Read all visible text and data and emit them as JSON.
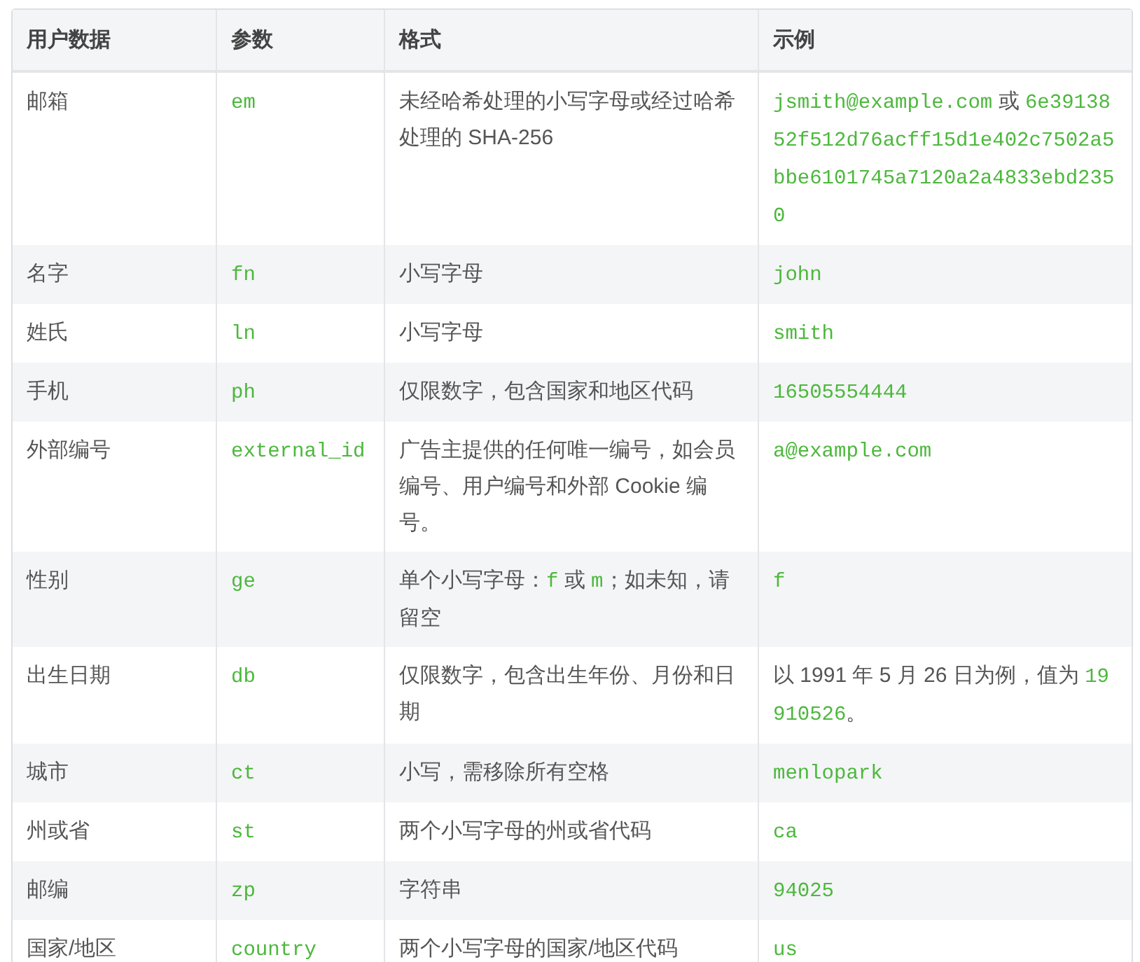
{
  "table": {
    "columns": [
      "用户数据",
      "参数",
      "格式",
      "示例"
    ],
    "rows": [
      {
        "data": "邮箱",
        "param": "em",
        "format": [
          {
            "kind": "text",
            "text": "未经哈希处理的小写字母或经过哈希处理的 SHA-256"
          }
        ],
        "example": [
          {
            "kind": "code",
            "text": "jsmith@example.com"
          },
          {
            "kind": "text",
            "text": " 或 "
          },
          {
            "kind": "code",
            "text": "6e3913852f512d76acff15d1e402c7502a5bbe6101745a7120a2a4833ebd2350"
          }
        ]
      },
      {
        "data": "名字",
        "param": "fn",
        "format": [
          {
            "kind": "text",
            "text": "小写字母"
          }
        ],
        "example": [
          {
            "kind": "code",
            "text": "john"
          }
        ]
      },
      {
        "data": "姓氏",
        "param": "ln",
        "format": [
          {
            "kind": "text",
            "text": "小写字母"
          }
        ],
        "example": [
          {
            "kind": "code",
            "text": "smith"
          }
        ]
      },
      {
        "data": "手机",
        "param": "ph",
        "format": [
          {
            "kind": "text",
            "text": "仅限数字，包含国家和地区代码"
          }
        ],
        "example": [
          {
            "kind": "code",
            "text": "16505554444"
          }
        ]
      },
      {
        "data": "外部编号",
        "param": "external_id",
        "format": [
          {
            "kind": "text",
            "text": "广告主提供的任何唯一编号，如会员编号、用户编号和外部 Cookie 编号。"
          }
        ],
        "example": [
          {
            "kind": "code",
            "text": "a@example.com"
          }
        ]
      },
      {
        "data": "性别",
        "param": "ge",
        "format": [
          {
            "kind": "text",
            "text": "单个小写字母："
          },
          {
            "kind": "code",
            "text": "f"
          },
          {
            "kind": "text",
            "text": " 或 "
          },
          {
            "kind": "code",
            "text": "m"
          },
          {
            "kind": "text",
            "text": "；如未知，请留空"
          }
        ],
        "example": [
          {
            "kind": "code",
            "text": "f"
          }
        ]
      },
      {
        "data": "出生日期",
        "param": "db",
        "format": [
          {
            "kind": "text",
            "text": "仅限数字，包含出生年份、月份和日期"
          }
        ],
        "example": [
          {
            "kind": "text",
            "text": "以 1991 年 5 月 26 日为例，值为 "
          },
          {
            "kind": "code",
            "text": "19910526"
          },
          {
            "kind": "text",
            "text": "。"
          }
        ]
      },
      {
        "data": "城市",
        "param": "ct",
        "format": [
          {
            "kind": "text",
            "text": "小写，需移除所有空格"
          }
        ],
        "example": [
          {
            "kind": "code",
            "text": "menlopark"
          }
        ]
      },
      {
        "data": "州或省",
        "param": "st",
        "format": [
          {
            "kind": "text",
            "text": "两个小写字母的州或省代码"
          }
        ],
        "example": [
          {
            "kind": "code",
            "text": "ca"
          }
        ]
      },
      {
        "data": "邮编",
        "param": "zp",
        "format": [
          {
            "kind": "text",
            "text": "字符串"
          }
        ],
        "example": [
          {
            "kind": "code",
            "text": "94025"
          }
        ]
      },
      {
        "data": "国家/地区",
        "param": "country",
        "format": [
          {
            "kind": "text",
            "text": "两个小写字母的国家/地区代码"
          }
        ],
        "example": [
          {
            "kind": "code",
            "text": "us"
          }
        ]
      }
    ]
  }
}
